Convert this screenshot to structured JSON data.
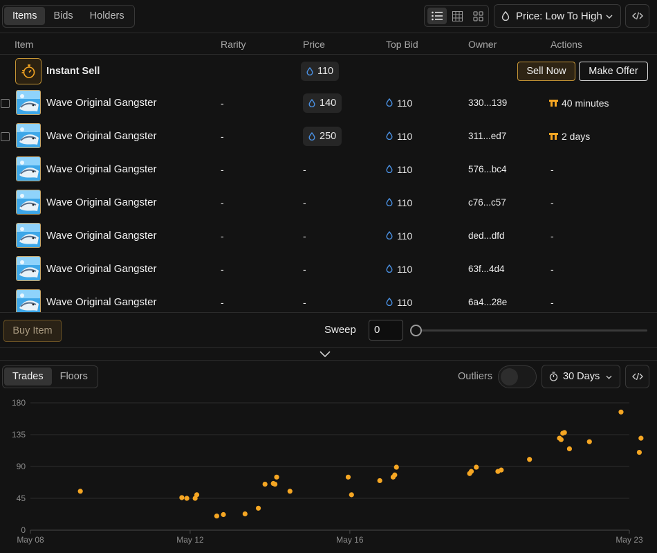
{
  "tabs": {
    "items": "Items",
    "bids": "Bids",
    "holders": "Holders"
  },
  "sort": {
    "label": "Price: Low To High"
  },
  "columns": {
    "item": "Item",
    "rarity": "Rarity",
    "price": "Price",
    "top_bid": "Top Bid",
    "owner": "Owner",
    "actions": "Actions"
  },
  "instant_sell": {
    "label": "Instant Sell",
    "price": "110",
    "sell_now": "Sell Now",
    "make_offer": "Make Offer"
  },
  "rows": [
    {
      "name": "Wave Original Gangster",
      "rarity": "-",
      "price": "140",
      "top_bid": "110",
      "owner": "330...139",
      "action": "40 minutes"
    },
    {
      "name": "Wave Original Gangster",
      "rarity": "-",
      "price": "250",
      "top_bid": "110",
      "owner": "311...ed7",
      "action": "2 days"
    },
    {
      "name": "Wave Original Gangster",
      "rarity": "-",
      "price": "-",
      "top_bid": "110",
      "owner": "576...bc4",
      "action": "-"
    },
    {
      "name": "Wave Original Gangster",
      "rarity": "-",
      "price": "-",
      "top_bid": "110",
      "owner": "c76...c57",
      "action": "-"
    },
    {
      "name": "Wave Original Gangster",
      "rarity": "-",
      "price": "-",
      "top_bid": "110",
      "owner": "ded...dfd",
      "action": "-"
    },
    {
      "name": "Wave Original Gangster",
      "rarity": "-",
      "price": "-",
      "top_bid": "110",
      "owner": "63f...4d4",
      "action": "-"
    },
    {
      "name": "Wave Original Gangster",
      "rarity": "-",
      "price": "-",
      "top_bid": "110",
      "owner": "6a4...28e",
      "action": "-"
    }
  ],
  "buy_item": "Buy Item",
  "sweep": {
    "label": "Sweep",
    "value": "0",
    "level": 0
  },
  "chart_tabs": {
    "trades": "Trades",
    "floors": "Floors"
  },
  "outliers": {
    "label": "Outliers",
    "on": false
  },
  "period": {
    "label": "30 Days"
  },
  "colors": {
    "accent": "#f5a623",
    "drop": "#4a90e2",
    "sell_border": "#c69636"
  },
  "chart_data": {
    "type": "scatter",
    "title": "",
    "xlabel": "",
    "ylabel": "",
    "ylim": [
      0,
      180
    ],
    "yticks": [
      "0",
      "45",
      "90",
      "135",
      "180"
    ],
    "xticks": [
      {
        "label": "May 08",
        "x": "2024-05-08"
      },
      {
        "label": "May 12",
        "x": "2024-05-12"
      },
      {
        "label": "May 16",
        "x": "2024-05-16"
      },
      {
        "label": "May 23",
        "x": "2024-05-23"
      }
    ],
    "xlim": [
      "2024-05-08",
      "2024-05-23"
    ],
    "grid": true,
    "color": "#f5a623",
    "series": [
      {
        "points": [
          [
            "2024-05-09 06:00",
            55
          ],
          [
            "2024-05-11 19:00",
            46
          ],
          [
            "2024-05-11 22:00",
            45
          ],
          [
            "2024-05-12 03:00",
            45
          ],
          [
            "2024-05-12 04:00",
            50
          ],
          [
            "2024-05-12 16:00",
            20
          ],
          [
            "2024-05-12 20:00",
            22
          ],
          [
            "2024-05-13 09:00",
            23
          ],
          [
            "2024-05-13 17:00",
            31
          ],
          [
            "2024-05-13 21:00",
            65
          ],
          [
            "2024-05-14 02:00",
            66
          ],
          [
            "2024-05-14 03:00",
            65
          ],
          [
            "2024-05-14 04:00",
            75
          ],
          [
            "2024-05-14 12:00",
            55
          ],
          [
            "2024-05-15 23:00",
            75
          ],
          [
            "2024-05-16 01:00",
            50
          ],
          [
            "2024-05-16 18:00",
            70
          ],
          [
            "2024-05-17 02:00",
            75
          ],
          [
            "2024-05-17 03:00",
            78
          ],
          [
            "2024-05-17 04:00",
            89
          ],
          [
            "2024-05-19 00:00",
            80
          ],
          [
            "2024-05-19 01:00",
            83
          ],
          [
            "2024-05-19 04:00",
            89
          ],
          [
            "2024-05-19 17:00",
            83
          ],
          [
            "2024-05-19 19:00",
            85
          ],
          [
            "2024-05-20 12:00",
            100
          ],
          [
            "2024-05-21 06:00",
            130
          ],
          [
            "2024-05-21 07:00",
            128
          ],
          [
            "2024-05-21 08:00",
            137
          ],
          [
            "2024-05-21 09:00",
            138
          ],
          [
            "2024-05-21 12:00",
            115
          ],
          [
            "2024-05-22 00:00",
            125
          ],
          [
            "2024-05-22 19:00",
            167
          ],
          [
            "2024-05-23 06:00",
            110
          ],
          [
            "2024-05-23 07:00",
            130
          ]
        ]
      }
    ]
  }
}
